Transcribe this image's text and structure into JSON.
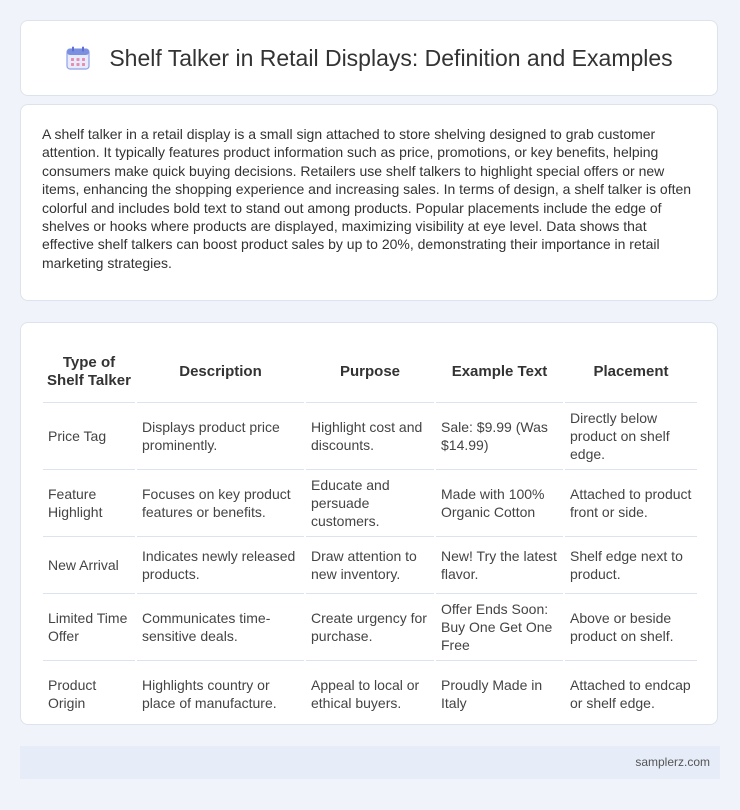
{
  "header": {
    "icon": "calendar-icon",
    "title": "Shelf Talker in Retail Displays: Definition and Examples"
  },
  "intro": {
    "text": "A shelf talker in a retail display is a small sign attached to store shelving designed to grab customer attention. It typically features product information such as price, promotions, or key benefits, helping consumers make quick buying decisions. Retailers use shelf talkers to highlight special offers or new items, enhancing the shopping experience and increasing sales. In terms of design, a shelf talker is often colorful and includes bold text to stand out among products. Popular placements include the edge of shelves or hooks where products are displayed, maximizing visibility at eye level. Data shows that effective shelf talkers can boost product sales by up to 20%, demonstrating their importance in retail marketing strategies."
  },
  "table": {
    "headers": [
      "Type of Shelf Talker",
      "Description",
      "Purpose",
      "Example Text",
      "Placement"
    ],
    "rows": [
      [
        "Price Tag",
        "Displays product price prominently.",
        "Highlight cost and discounts.",
        "Sale: $9.99 (Was $14.99)",
        "Directly below product on shelf edge."
      ],
      [
        "Feature Highlight",
        "Focuses on key product features or benefits.",
        "Educate and persuade customers.",
        "Made with 100% Organic Cotton",
        "Attached to product front or side."
      ],
      [
        "New Arrival",
        "Indicates newly released products.",
        "Draw attention to new inventory.",
        "New! Try the latest flavor.",
        "Shelf edge next to product."
      ],
      [
        "Limited Time Offer",
        "Communicates time-sensitive deals.",
        "Create urgency for purchase.",
        "Offer Ends Soon: Buy One Get One Free",
        "Above or beside product on shelf."
      ],
      [
        "Product Origin",
        "Highlights country or place of manufacture.",
        "Appeal to local or ethical buyers.",
        "Proudly Made in Italy",
        "Attached to endcap or shelf edge."
      ]
    ]
  },
  "footer": {
    "text": "samplerz.com"
  },
  "colors": {
    "page_bg": "#f0f3f9",
    "card_border": "#dde3ee",
    "footer_bg": "#e6edf8",
    "icon_accent": "#7b8fe0"
  }
}
